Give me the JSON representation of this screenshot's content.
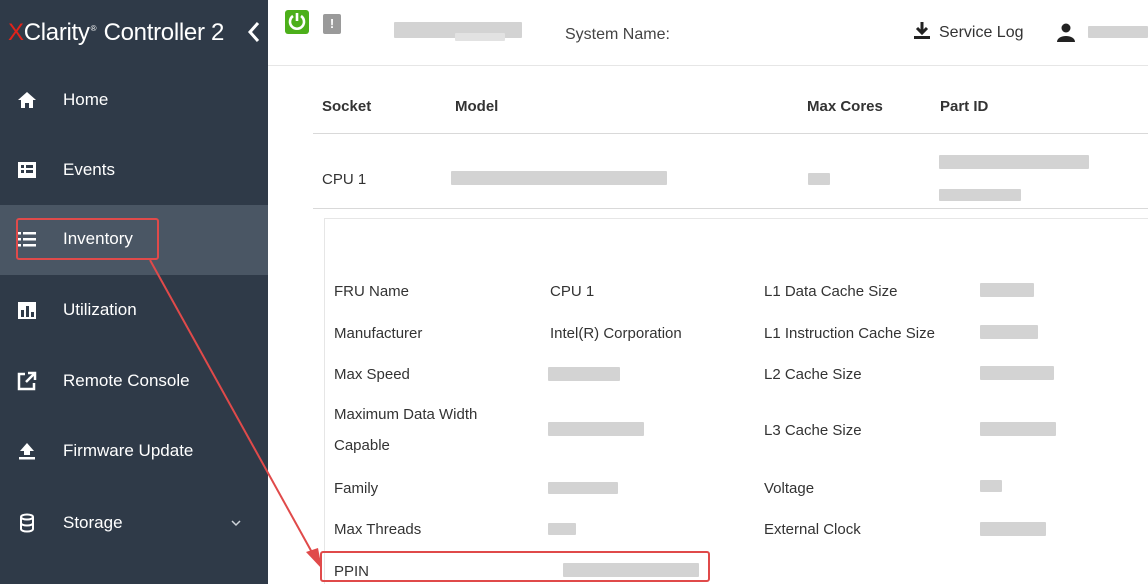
{
  "brand": {
    "x": "X",
    "rest": "Clarity",
    "tm": "®",
    "product": " Controller 2",
    "collapse_icon": "chevron-left-icon"
  },
  "nav": {
    "items": [
      {
        "label": "Home",
        "icon": "home-icon"
      },
      {
        "label": "Events",
        "icon": "events-icon"
      },
      {
        "label": "Inventory",
        "icon": "list-icon",
        "active": true
      },
      {
        "label": "Utilization",
        "icon": "chart-icon"
      },
      {
        "label": "Remote Console",
        "icon": "external-link-icon"
      },
      {
        "label": "Firmware Update",
        "icon": "upload-icon"
      },
      {
        "label": "Storage",
        "icon": "database-icon",
        "expand_icon": "chevron-down-icon"
      }
    ]
  },
  "header": {
    "system_name_label": "System Name:",
    "service_log_label": "Service Log",
    "power_icon": "power-icon",
    "alert_icon": "exclamation-icon",
    "download_icon": "download-icon",
    "user_icon": "user-icon",
    "alert_glyph": "!"
  },
  "table": {
    "columns": [
      "Socket",
      "Model",
      "Max Cores",
      "Part ID"
    ],
    "rows": [
      {
        "socket": "CPU 1"
      }
    ]
  },
  "detail": {
    "left_labels": [
      "FRU Name",
      "Manufacturer",
      "Max Speed",
      "Maximum Data Width",
      "Capable",
      "Family",
      "Max Threads",
      "PPIN"
    ],
    "left_values": {
      "fru_name": "CPU 1",
      "manufacturer": "Intel(R) Corporation"
    },
    "right_labels": [
      "L1 Data Cache Size",
      "L1 Instruction Cache Size",
      "L2 Cache Size",
      "L3 Cache Size",
      "Voltage",
      "External Clock"
    ]
  },
  "colors": {
    "sidebar": "#2f3a48",
    "active": "#4a5664",
    "power": "#4caf1a",
    "annotation": "#e04a4a",
    "brand_x": "#e2231a"
  }
}
